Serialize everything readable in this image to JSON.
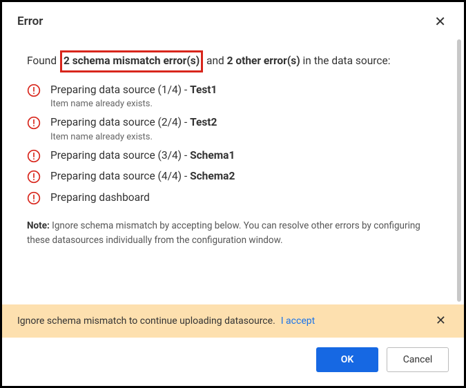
{
  "dialog": {
    "title": "Error",
    "close_glyph": "✕"
  },
  "summary": {
    "prefix": "Found",
    "schema_errors": "2 schema mismatch error(s)",
    "mid": " and ",
    "other_errors": "2 other error(s)",
    "suffix": " in the data source:"
  },
  "errors": [
    {
      "prefix": "Preparing data source (1/4) - ",
      "name": "Test1",
      "sub": "Item name already exists."
    },
    {
      "prefix": "Preparing data source (2/4) - ",
      "name": "Test2",
      "sub": "Item name already exists."
    },
    {
      "prefix": "Preparing data source (3/4) - ",
      "name": "Schema1",
      "sub": ""
    },
    {
      "prefix": "Preparing data source (4/4) - ",
      "name": "Schema2",
      "sub": ""
    },
    {
      "prefix": "Preparing dashboard",
      "name": "",
      "sub": ""
    }
  ],
  "note": {
    "label": "Note:",
    "text": " Ignore schema mismatch by accepting below. You can resolve other errors by configuring these datasources individually from the configuration window."
  },
  "banner": {
    "text": "Ignore schema mismatch to continue uploading datasource.",
    "link": "I accept",
    "close_glyph": "✕"
  },
  "footer": {
    "ok": "OK",
    "cancel": "Cancel"
  }
}
